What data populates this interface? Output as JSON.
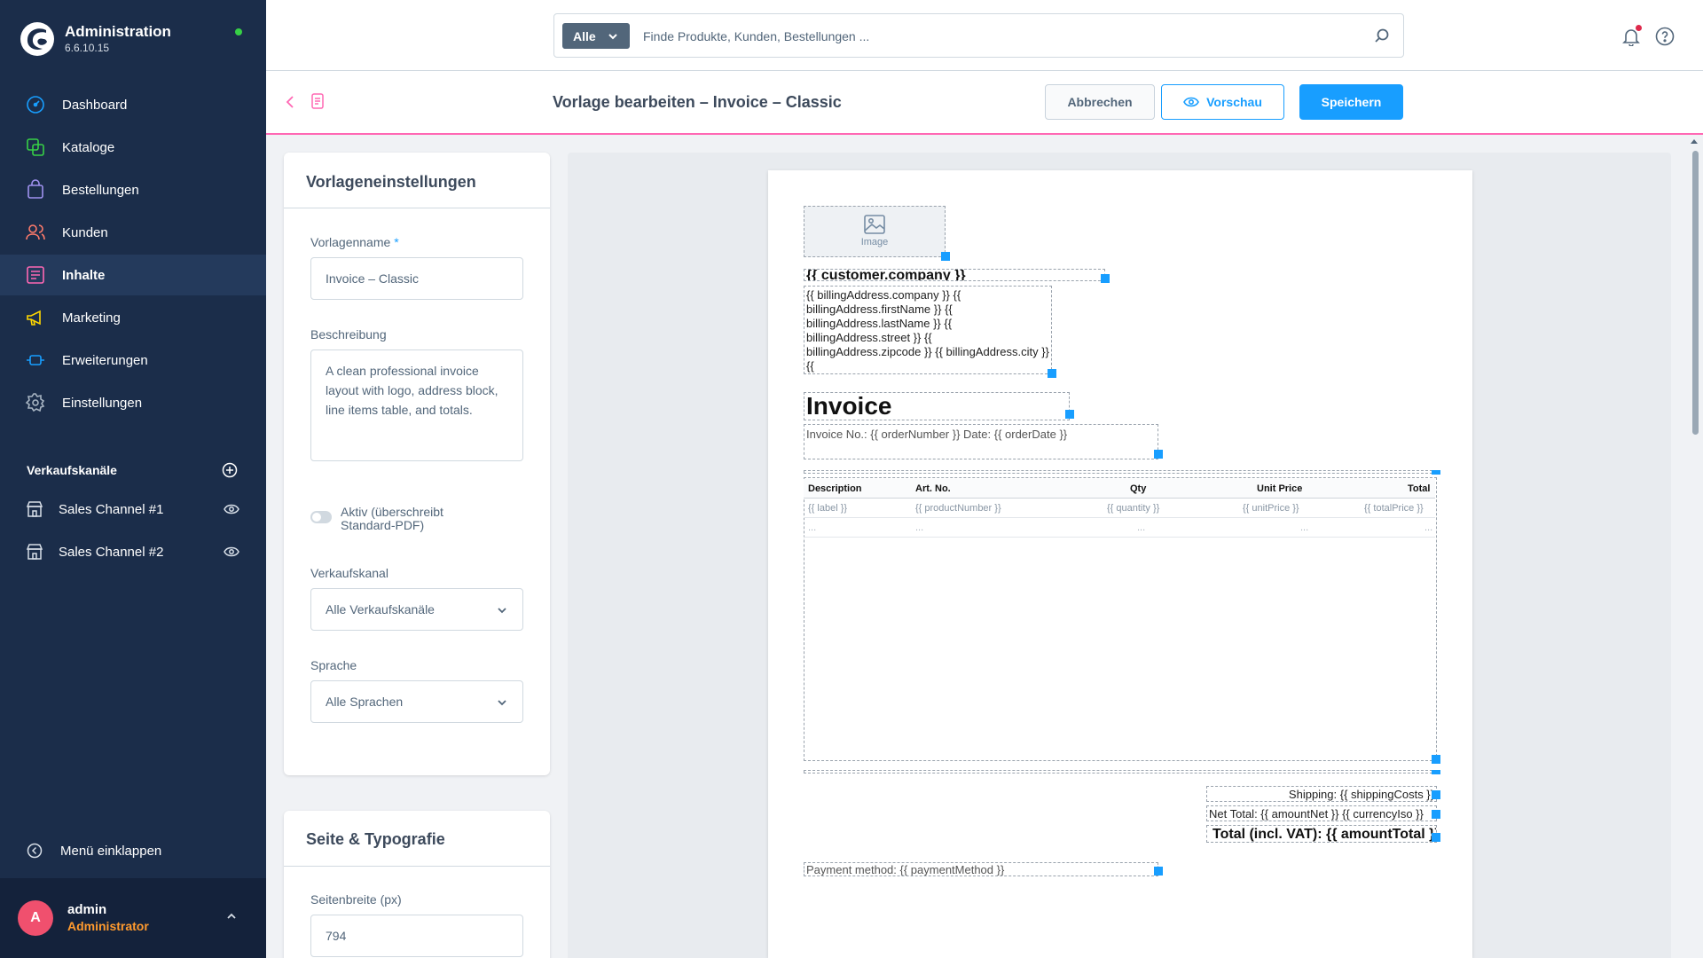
{
  "app": {
    "title": "Administration",
    "version": "6.6.10.15",
    "online_color": "#37d046"
  },
  "sidebar": {
    "items": [
      {
        "label": "Dashboard",
        "icon": "dashboard-icon"
      },
      {
        "label": "Kataloge",
        "icon": "catalog-icon"
      },
      {
        "label": "Bestellungen",
        "icon": "orders-icon"
      },
      {
        "label": "Kunden",
        "icon": "customers-icon"
      },
      {
        "label": "Inhalte",
        "icon": "content-icon",
        "active": true
      },
      {
        "label": "Marketing",
        "icon": "marketing-icon"
      },
      {
        "label": "Erweiterungen",
        "icon": "extensions-icon"
      },
      {
        "label": "Einstellungen",
        "icon": "settings-icon"
      }
    ],
    "sales_channels_title": "Verkaufskanäle",
    "sales_channels": [
      {
        "label": "Sales Channel #1"
      },
      {
        "label": "Sales Channel #2"
      }
    ],
    "collapse_label": "Menü einklappen",
    "user": {
      "initial": "A",
      "name": "admin",
      "role": "Administrator"
    }
  },
  "topbar": {
    "search_type": "Alle",
    "search_placeholder": "Finde Produkte, Kunden, Bestellungen ..."
  },
  "smartbar": {
    "title": "Vorlage bearbeiten – Invoice – Classic",
    "cancel_label": "Abbrechen",
    "preview_label": "Vorschau",
    "save_label": "Speichern"
  },
  "settings_card": {
    "title": "Vorlageneinstellungen",
    "name_label": "Vorlagenname",
    "name_required_mark": "*",
    "name_value": "Invoice – Classic",
    "description_label": "Beschreibung",
    "description_value": "A clean professional invoice layout with logo, address block, line items table, and totals.",
    "active_label": "Aktiv (überschreibt Standard-PDF)",
    "active": false,
    "channel_label": "Verkaufskanal",
    "channel_value": "Alle Verkaufskanäle",
    "language_label": "Sprache",
    "language_value": "Alle Sprachen"
  },
  "typography_card": {
    "title": "Seite & Typografie",
    "page_width_label": "Seitenbreite (px)",
    "page_width_value": "794"
  },
  "document": {
    "image_label": "Image",
    "company": "{{ customer.company }}",
    "address": "{{ billingAddress.company }} {{ billingAddress.firstName }} {{ billingAddress.lastName }} {{ billingAddress.street }} {{ billingAddress.zipcode }} {{ billingAddress.city }} {{",
    "heading": "Invoice",
    "invoice_meta": "Invoice No.: {{ orderNumber }} Date: {{ orderDate }}",
    "table": {
      "headers": [
        "Description",
        "Art. No.",
        "Qty",
        "Unit Price",
        "Total"
      ],
      "row": [
        "{{ label }}",
        "{{ productNumber }}",
        "{{ quantity }}",
        "{{ unitPrice }}",
        "{{ totalPrice }}"
      ],
      "empty_row": [
        "...",
        "...",
        "...",
        "...",
        "..."
      ]
    },
    "shipping": "Shipping: {{ shippingCosts }}",
    "net_total": "Net Total: {{ amountNet }} {{ currencyIso }}",
    "total": "Total (incl. VAT): {{ amountTotal }}",
    "payment": "Payment method: {{ paymentMethod }}"
  },
  "colors": {
    "sidebar_bg": "#1b2d4a",
    "accent": "#189eff",
    "smartbar_border": "#ff68b4",
    "notification": "#de294c",
    "user_role": "#ff9a2e"
  }
}
